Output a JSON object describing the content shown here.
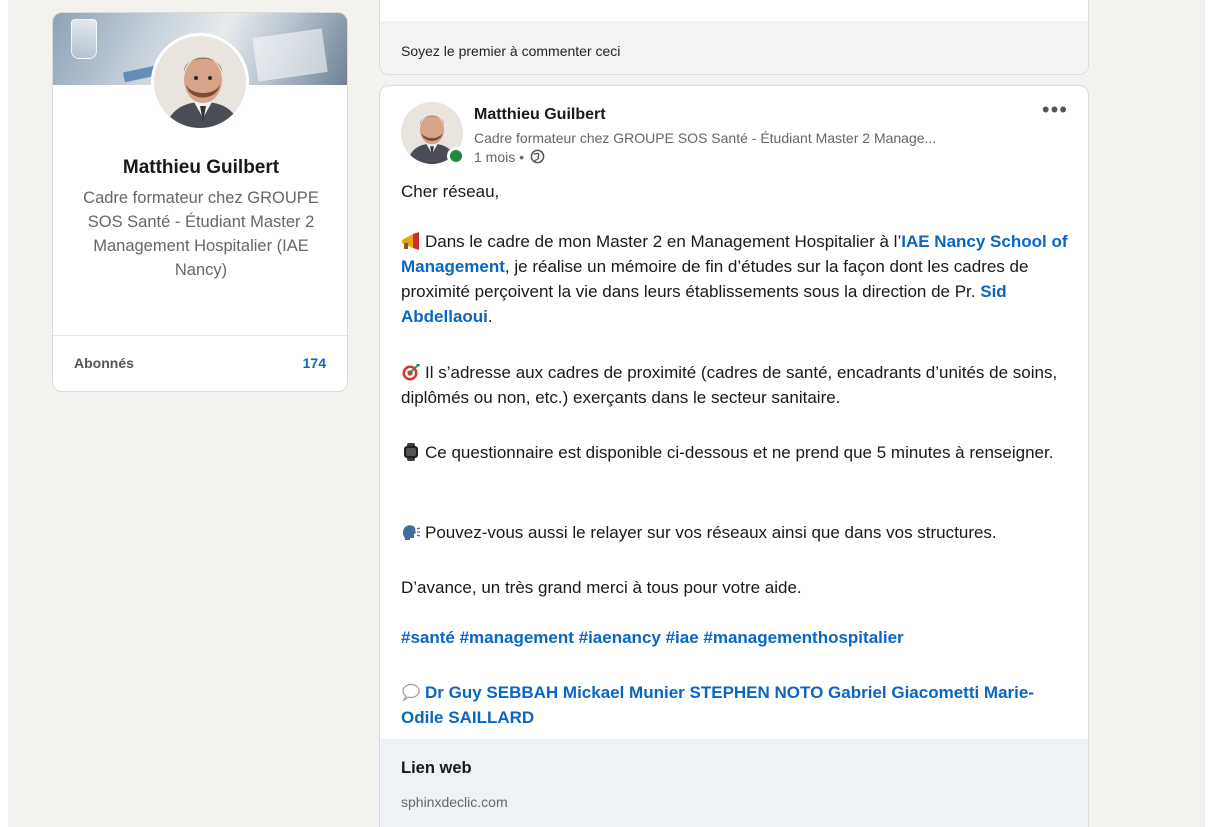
{
  "profile": {
    "name": "Matthieu Guilbert",
    "headline": "Cadre formateur chez GROUPE SOS Santé - Étudiant Master 2 Management Hospitalier (IAE Nancy)",
    "followers_label": "Abonnés",
    "followers_count": "174",
    "avatar_icon": "profile-photo",
    "cover_icon": "cover-image"
  },
  "previous_post": {
    "comment_prompt": "Soyez le premier à commenter ceci"
  },
  "post": {
    "author": {
      "name": "Matthieu Guilbert",
      "headline": "Cadre formateur chez GROUPE SOS Santé - Étudiant Master 2 Manage...",
      "time": "1 mois •",
      "visibility_icon": "globe-icon",
      "online_status_color": "#1e8a3e"
    },
    "more_label": "•••",
    "body": {
      "greeting": "Cher réseau,",
      "p1_prefix": "Dans le cadre de mon Master 2 en Management Hospitalier à l’",
      "p1_link1": "IAE Nancy School of Management",
      "p1_middle": ", je réalise un mémoire de fin d’études sur la façon dont les cadres de proximité perçoivent la vie dans leurs établissements sous la direction de Pr. ",
      "p1_link2": "Sid Abdellaoui",
      "p1_suffix": ".",
      "p2": "Il s’adresse aux cadres de proximité (cadres de santé, encadrants d’unités de soins, diplômés ou non, etc.) exerçants dans le secteur sanitaire.",
      "p3": "Ce questionnaire est disponible ci-dessous et ne prend que 5 minutes à renseigner.",
      "p4": "Pouvez-vous aussi le relayer sur vos réseaux ainsi que dans vos structures.",
      "p5": "D’avance, un très grand merci à tous pour votre aide.",
      "hashtags": "#santé #management #iaenancy #iae #managementhospitalier",
      "mentions": "Dr Guy SEBBAH Mickael Munier STEPHEN NOTO Gabriel Giacometti Marie-Odile SAILLARD",
      "emoji_icons": [
        "megaphone-icon",
        "target-icon",
        "watch-icon",
        "speaking-head-icon",
        "speech-bubble-icon"
      ]
    },
    "web_link": {
      "title": "Lien web",
      "url": "sphinxdeclic.com"
    }
  },
  "colors": {
    "link": "#0a66c2",
    "page_bg": "#f3f2ef",
    "web_link_bg": "#eef2f6"
  }
}
